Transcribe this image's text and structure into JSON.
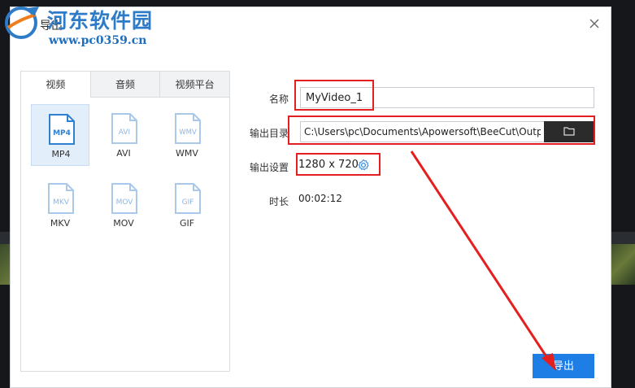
{
  "watermark": {
    "name": "河东软件园",
    "url": "www.pc0359.cn"
  },
  "dialog": {
    "title": "导出"
  },
  "tabs": [
    {
      "label": "视频",
      "active": true
    },
    {
      "label": "音频",
      "active": false
    },
    {
      "label": "视频平台",
      "active": false
    }
  ],
  "formats": [
    {
      "label": "MP4",
      "icon_text": "MP4",
      "selected": true
    },
    {
      "label": "AVI",
      "icon_text": "AVI",
      "selected": false
    },
    {
      "label": "WMV",
      "icon_text": "WMV",
      "selected": false
    },
    {
      "label": "MKV",
      "icon_text": "MKV",
      "selected": false
    },
    {
      "label": "MOV",
      "icon_text": "MOV",
      "selected": false
    },
    {
      "label": "GIF",
      "icon_text": "GIF",
      "selected": false
    }
  ],
  "form": {
    "name_label": "名称",
    "name_value": "MyVideo_1",
    "dir_label": "输出目录",
    "dir_value": "C:\\Users\\pc\\Documents\\Apowersoft\\BeeCut\\Output",
    "settings_label": "输出设置",
    "resolution": "1280 x 720",
    "duration_label": "时长",
    "duration_value": "00:02:12"
  },
  "export_button": "导出",
  "colors": {
    "accent": "#1f7ee6",
    "annotation": "#e3201f",
    "selected_bg": "#e3eefb"
  }
}
